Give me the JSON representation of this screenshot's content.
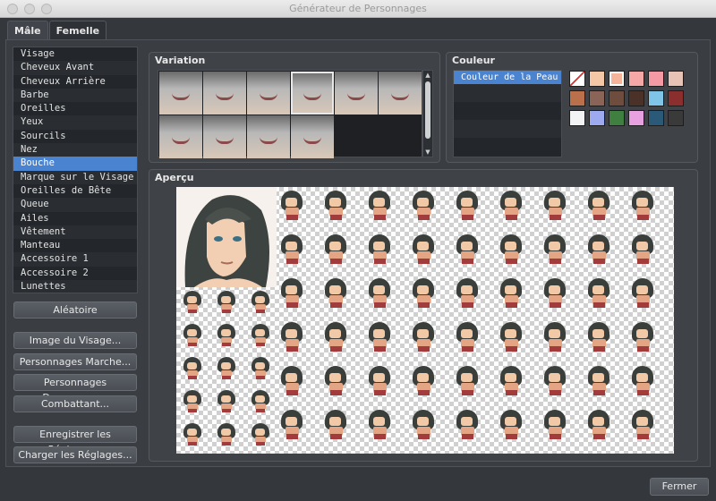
{
  "window": {
    "title": "Générateur de Personnages"
  },
  "tabs": [
    {
      "label": "Mâle",
      "active": true
    },
    {
      "label": "Femelle",
      "active": false
    }
  ],
  "parts": [
    "Visage",
    "Cheveux Avant",
    "Cheveux Arrière",
    "Barbe",
    "Oreilles",
    "Yeux",
    "Sourcils",
    "Nez",
    "Bouche",
    "Marque sur le Visage",
    "Oreilles de Bête",
    "Queue",
    "Ailes",
    "Vêtement",
    "Manteau",
    "Accessoire 1",
    "Accessoire 2",
    "Lunettes"
  ],
  "selected_part": "Bouche",
  "buttons": {
    "random": "Aléatoire",
    "face_image": "Image du Visage...",
    "walking": "Personnages Marche...",
    "damage": "Personnages Dommages...",
    "battler": "Combattant...",
    "save_settings": "Enregistrer les Réglages...",
    "load_settings": "Charger les Réglages...",
    "close": "Fermer"
  },
  "variation": {
    "title": "Variation",
    "count": 10,
    "selected_index": 3
  },
  "color": {
    "title": "Couleur",
    "items": [
      "Couleur de la Peau"
    ],
    "swatches": [
      "none",
      "#f4c8a6",
      "#f6b59a",
      "#f5a6a6",
      "#f59aa5",
      "#e6c3b4",
      "#b9704b",
      "#8a6557",
      "#6e4c3e",
      "#4a3228",
      "#7fc5e8",
      "#8b2e2e",
      "#f3f2f5",
      "#9eaaf0",
      "#3f7f3f",
      "#e8a0e0",
      "#2b5a78",
      "#3a3a3a"
    ],
    "selected_swatch": 2
  },
  "preview": {
    "title": "Aperçu"
  }
}
